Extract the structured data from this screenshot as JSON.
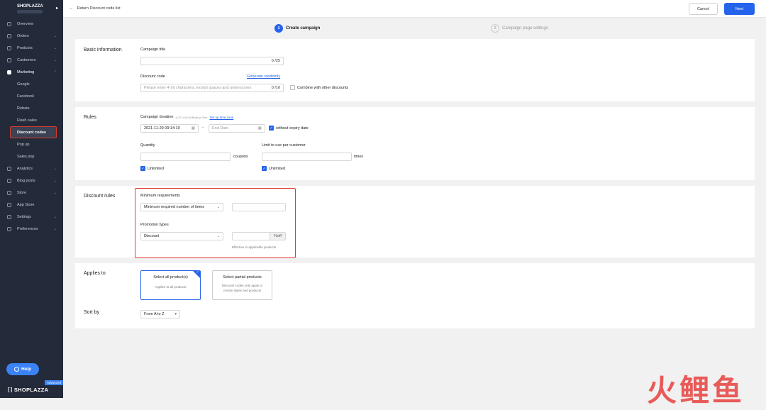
{
  "sidebar": {
    "store_name": "SHOPLAZZA",
    "items": [
      {
        "label": "Overview",
        "icon": "overview-icon",
        "has_chevron": false
      },
      {
        "label": "Orders",
        "icon": "orders-icon",
        "has_chevron": true
      },
      {
        "label": "Products",
        "icon": "products-icon",
        "has_chevron": true
      },
      {
        "label": "Customers",
        "icon": "customers-icon",
        "has_chevron": true
      },
      {
        "label": "Marketing",
        "icon": "marketing-icon",
        "has_chevron": true,
        "expanded": true
      }
    ],
    "marketing_sub": [
      "Google",
      "Facebook",
      "Rebate",
      "Flash sales",
      "Discount codes",
      "Pop up",
      "Sales pop"
    ],
    "items_after": [
      {
        "label": "Analytics",
        "icon": "analytics-icon",
        "has_chevron": true
      },
      {
        "label": "Blog posts",
        "icon": "blog-icon",
        "has_chevron": true
      },
      {
        "label": "Store",
        "icon": "store-icon",
        "has_chevron": true
      },
      {
        "label": "App Store",
        "icon": "app-store-icon",
        "has_chevron": false
      },
      {
        "label": "Settings",
        "icon": "settings-icon",
        "has_chevron": true
      },
      {
        "label": "Preferences",
        "icon": "preferences-icon",
        "has_chevron": true
      }
    ],
    "help_label": "Help",
    "advanced_badge": "Advanced",
    "brand": "SHOPLAZZA"
  },
  "topbar": {
    "back_label": "Return Discount code list",
    "cancel_label": "Cancel",
    "next_label": "Next"
  },
  "steps": [
    {
      "num": "1",
      "label": "Create campaign",
      "active": true
    },
    {
      "num": "2",
      "label": "Campaign page settings",
      "active": false
    }
  ],
  "basic_info": {
    "title": "Basic information",
    "campaign_title_label": "Campaign title",
    "campaign_title_value": "",
    "campaign_title_count": "0 /25",
    "discount_code_label": "Discount code",
    "generate_label": "Generate randomly",
    "discount_code_placeholder": "Please enter 4-16 characters, except spaces and underscores",
    "discount_code_count": "0 /16",
    "combine_label": "Combine with other discounts"
  },
  "rules": {
    "title": "Rules",
    "duration_label": "Campaign duration",
    "timezone_note": "(UTC+08:00)Beijing Time",
    "set_timezone_label": "Set up time zone",
    "start_date": "2021-11-29 09:14:10",
    "end_date_placeholder": "End Date",
    "date_separator": "-",
    "without_expiry_label": "without expiry date",
    "quantity_label": "Quantity",
    "quantity_unit": "coupons",
    "quantity_unlimited": "Unlimited",
    "limit_label": "Limit to use per customer",
    "limit_unit": "times",
    "limit_unlimited": "Unlimited"
  },
  "discount_rules": {
    "title": "Discount rules",
    "min_req_label": "Minimum requirements",
    "min_req_selected": "Minimum required number of items",
    "promo_label": "Promotion types",
    "promo_selected": "Discount",
    "percent_suffix": "%off",
    "effective_note": "Effective to applicable products"
  },
  "applies_to": {
    "title": "Applies to",
    "options": [
      {
        "title": "Select all product(s)",
        "desc": "Applies to all products",
        "selected": true
      },
      {
        "title": "Select partial products",
        "desc": "Discount codes only apply to certain styles and products",
        "selected": false
      }
    ]
  },
  "sort_by": {
    "title": "Sort by",
    "selected": "From A to Z"
  },
  "watermark": "火鲤鱼",
  "colors": {
    "accent": "#2563eb",
    "sidebar_bg": "#232a3a",
    "highlight": "#e0392b"
  }
}
